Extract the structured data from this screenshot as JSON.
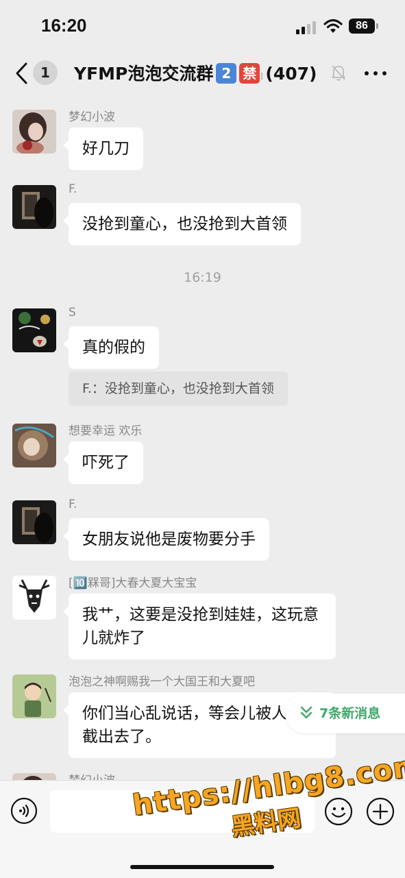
{
  "status_bar": {
    "time": "16:20",
    "battery": "86"
  },
  "nav": {
    "unread_count": "1",
    "title": "YFMP泡泡交流群",
    "badge_1": "2",
    "badge_2": "禁",
    "member_count": "(407)"
  },
  "chat": {
    "timestamp": "16:19",
    "messages": [
      {
        "sender": "梦幻小波",
        "text": "好几刀"
      },
      {
        "sender": "F.",
        "text": "没抢到童心，也没抢到大首领"
      },
      {
        "sender": "S",
        "text": "真的假的",
        "quote": "F.：没抢到童心，也没抢到大首领"
      },
      {
        "sender": "想要幸运 欢乐",
        "text": "吓死了"
      },
      {
        "sender": "F.",
        "text": "女朋友说他是废物要分手"
      },
      {
        "sender": "[🔟槑哥]大春大夏大宝宝",
        "text": "我艹，这要是没抢到娃娃，这玩意儿就炸了"
      },
      {
        "sender": "泡泡之神啊赐我一个大国王和大夏吧",
        "text": "你们当心乱说话，等会儿被人截图截出去了。"
      },
      {
        "sender": "梦幻小波"
      }
    ],
    "new_messages_label": "7条新消息"
  },
  "input": {
    "placeholder": ""
  },
  "watermark": {
    "url": "https://hlbg8.com",
    "name": "黑料网"
  },
  "colors": {
    "background": "#ededed",
    "bubble": "#ffffff",
    "accent_green": "#3fa86a",
    "watermark": "#f6a623"
  }
}
